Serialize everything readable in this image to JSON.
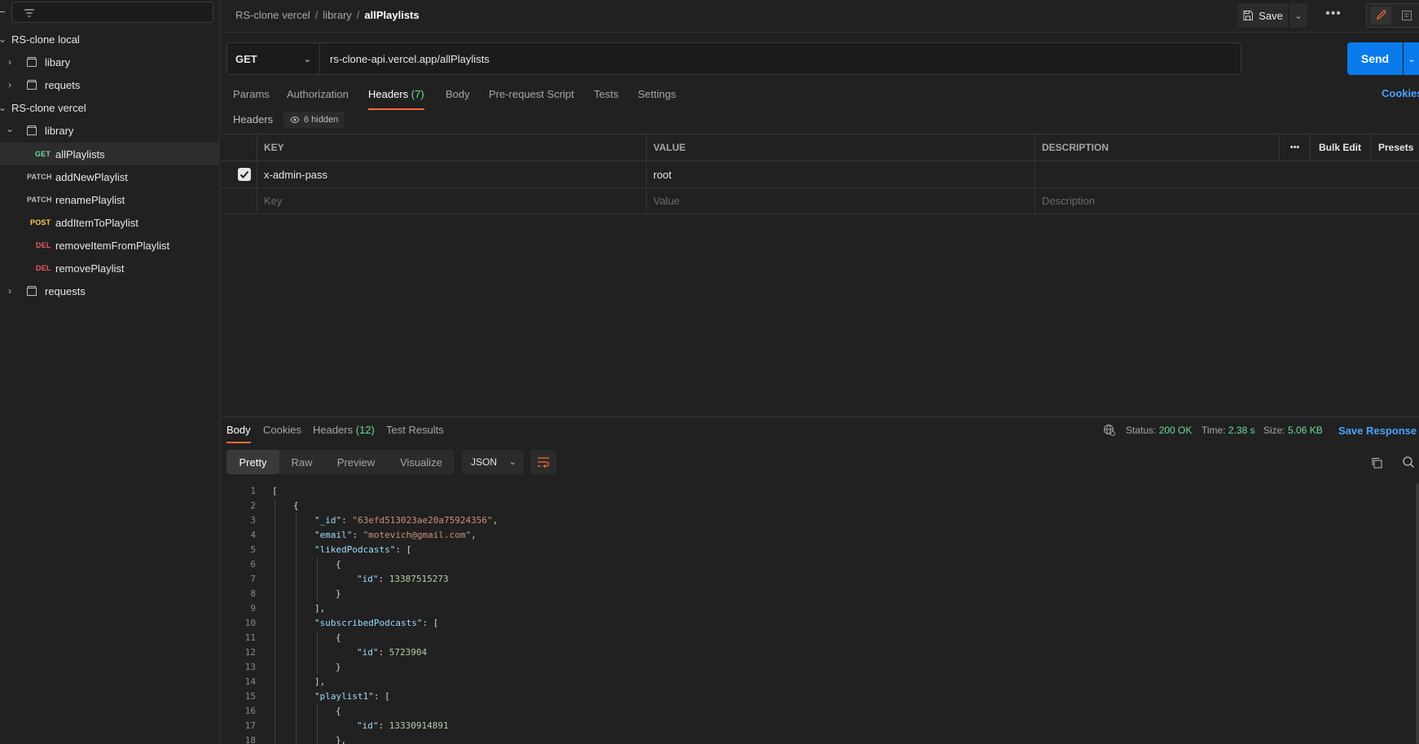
{
  "sidebar": {
    "collections": [
      {
        "name": "RS-clone local",
        "folders": [
          {
            "name": "libary"
          },
          {
            "name": "requets"
          }
        ]
      },
      {
        "name": "RS-clone vercel",
        "folders": [
          {
            "name": "library"
          },
          {
            "name": "requests"
          }
        ]
      }
    ],
    "requests": [
      {
        "method": "GET",
        "name": "allPlaylists",
        "selected": true
      },
      {
        "method": "PATCH",
        "name": "addNewPlaylist"
      },
      {
        "method": "PATCH",
        "name": "renamePlaylist"
      },
      {
        "method": "POST",
        "name": "addItemToPlaylist"
      },
      {
        "method": "DEL",
        "name": "removeItemFromPlaylist"
      },
      {
        "method": "DEL",
        "name": "removePlaylist"
      }
    ]
  },
  "breadcrumb": {
    "collection": "RS-clone vercel",
    "folder": "library",
    "current": "allPlaylists",
    "sep": "/"
  },
  "toolbar": {
    "save_label": "Save",
    "more_label": "•••"
  },
  "request": {
    "method": "GET",
    "url": "rs-clone-api.vercel.app/allPlaylists",
    "send_label": "Send"
  },
  "req_tabs": [
    {
      "label": "Params"
    },
    {
      "label": "Authorization"
    },
    {
      "label": "Headers",
      "count": "(7)",
      "active": true
    },
    {
      "label": "Body"
    },
    {
      "label": "Pre-request Script"
    },
    {
      "label": "Tests"
    },
    {
      "label": "Settings"
    }
  ],
  "cookies_label": "Cookies",
  "headers_section": {
    "title": "Headers",
    "hidden_label": "6 hidden"
  },
  "headers_table": {
    "columns": [
      "KEY",
      "VALUE",
      "DESCRIPTION"
    ],
    "more_label": "•••",
    "bulk_edit_label": "Bulk Edit",
    "presets_label": "Presets",
    "rows": [
      {
        "checked": true,
        "key": "x-admin-pass",
        "value": "root",
        "description": ""
      }
    ],
    "placeholders": {
      "key": "Key",
      "value": "Value",
      "description": "Description"
    }
  },
  "response": {
    "tabs": [
      {
        "label": "Body",
        "active": true
      },
      {
        "label": "Cookies"
      },
      {
        "label": "Headers",
        "count": "(12)"
      },
      {
        "label": "Test Results"
      }
    ],
    "status_label": "Status:",
    "status_value": "200 OK",
    "time_label": "Time:",
    "time_value": "2.38 s",
    "size_label": "Size:",
    "size_value": "5.06 KB",
    "save_label": "Save Response",
    "view_modes": [
      "Pretty",
      "Raw",
      "Preview",
      "Visualize"
    ],
    "active_view": "Pretty",
    "format": "JSON"
  },
  "code_lines": [
    {
      "n": "1",
      "indent": 0,
      "parts": [
        [
          "p",
          "["
        ]
      ]
    },
    {
      "n": "2",
      "indent": 1,
      "parts": [
        [
          "p",
          "{"
        ]
      ]
    },
    {
      "n": "3",
      "indent": 2,
      "parts": [
        [
          "k",
          "\"_id\""
        ],
        [
          "p",
          ": "
        ],
        [
          "s",
          "\"63efd513023ae20a75924356\""
        ],
        [
          "p",
          ","
        ]
      ]
    },
    {
      "n": "4",
      "indent": 2,
      "parts": [
        [
          "k",
          "\"email\""
        ],
        [
          "p",
          ": "
        ],
        [
          "s",
          "\"motevich@gmail.com\""
        ],
        [
          "p",
          ","
        ]
      ]
    },
    {
      "n": "5",
      "indent": 2,
      "parts": [
        [
          "k",
          "\"likedPodcasts\""
        ],
        [
          "p",
          ": ["
        ]
      ]
    },
    {
      "n": "6",
      "indent": 3,
      "parts": [
        [
          "p",
          "{"
        ]
      ]
    },
    {
      "n": "7",
      "indent": 4,
      "parts": [
        [
          "k",
          "\"id\""
        ],
        [
          "p",
          ": "
        ],
        [
          "n",
          "13387515273"
        ]
      ]
    },
    {
      "n": "8",
      "indent": 3,
      "parts": [
        [
          "p",
          "}"
        ]
      ]
    },
    {
      "n": "9",
      "indent": 2,
      "parts": [
        [
          "p",
          "],"
        ]
      ]
    },
    {
      "n": "10",
      "indent": 2,
      "parts": [
        [
          "k",
          "\"subscribedPodcasts\""
        ],
        [
          "p",
          ": ["
        ]
      ]
    },
    {
      "n": "11",
      "indent": 3,
      "parts": [
        [
          "p",
          "{"
        ]
      ]
    },
    {
      "n": "12",
      "indent": 4,
      "parts": [
        [
          "k",
          "\"id\""
        ],
        [
          "p",
          ": "
        ],
        [
          "n",
          "5723904"
        ]
      ]
    },
    {
      "n": "13",
      "indent": 3,
      "parts": [
        [
          "p",
          "}"
        ]
      ]
    },
    {
      "n": "14",
      "indent": 2,
      "parts": [
        [
          "p",
          "],"
        ]
      ]
    },
    {
      "n": "15",
      "indent": 2,
      "parts": [
        [
          "k",
          "\"playlist1\""
        ],
        [
          "p",
          ": ["
        ]
      ]
    },
    {
      "n": "16",
      "indent": 3,
      "parts": [
        [
          "p",
          "{"
        ]
      ]
    },
    {
      "n": "17",
      "indent": 4,
      "parts": [
        [
          "k",
          "\"id\""
        ],
        [
          "p",
          ": "
        ],
        [
          "n",
          "13330914891"
        ]
      ]
    },
    {
      "n": "18",
      "indent": 3,
      "parts": [
        [
          "p",
          "},"
        ]
      ]
    }
  ],
  "colors": {
    "accent": "#ff6c37",
    "send": "#097bed",
    "link": "#4aa3ff",
    "ok": "#6bdd9a"
  }
}
